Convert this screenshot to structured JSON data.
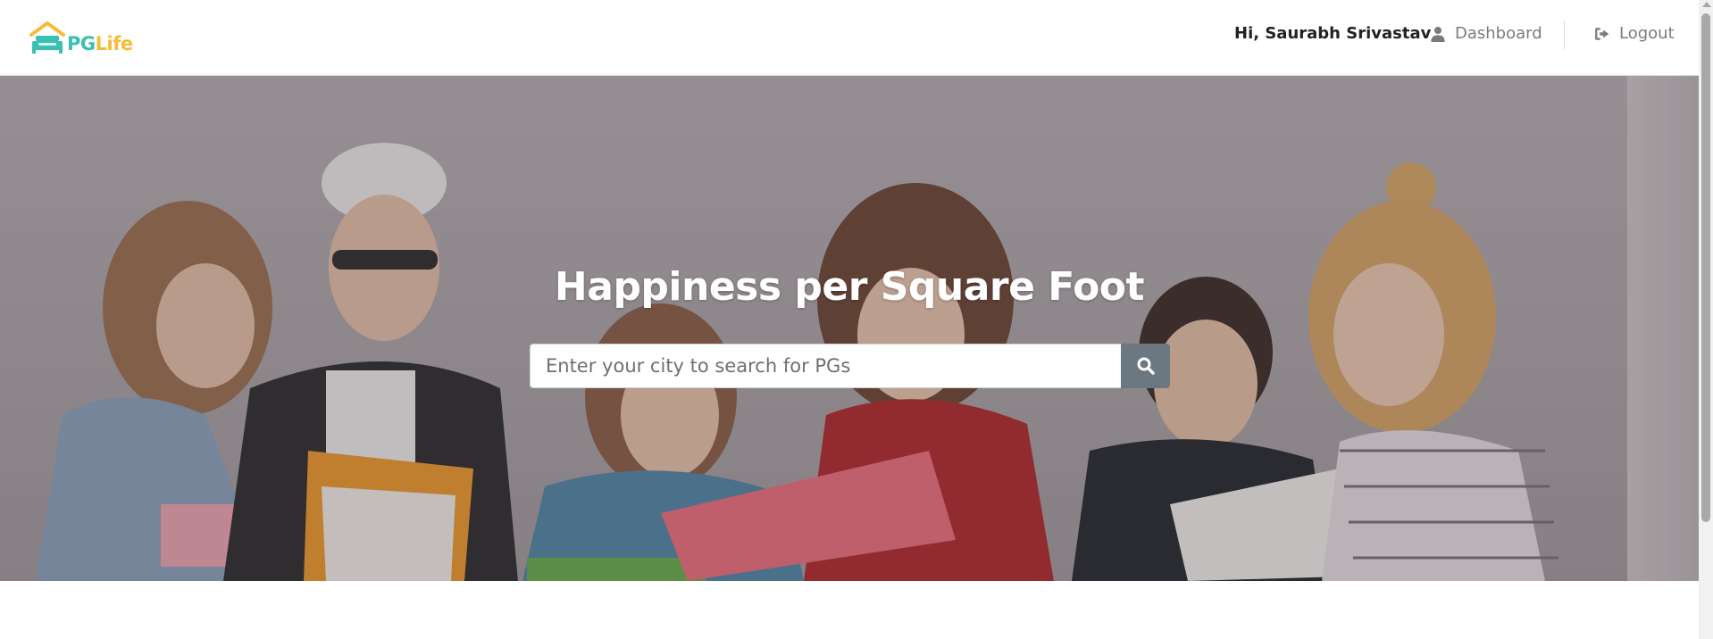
{
  "brand": {
    "pg": "PG",
    "life": "Life",
    "colors": {
      "teal": "#3ac0b3",
      "yellow": "#f3bd3a"
    }
  },
  "nav": {
    "greeting": "Hi, Saurabh Srivastav",
    "dashboard": "Dashboard",
    "logout": "Logout",
    "dashboard_icon": "user-icon",
    "logout_icon": "sign-out-icon"
  },
  "hero": {
    "title": "Happiness per Square Foot",
    "search_placeholder": "Enter your city to search for PGs",
    "search_value": "",
    "search_icon": "search-icon",
    "search_button_color": "#6b7781"
  }
}
